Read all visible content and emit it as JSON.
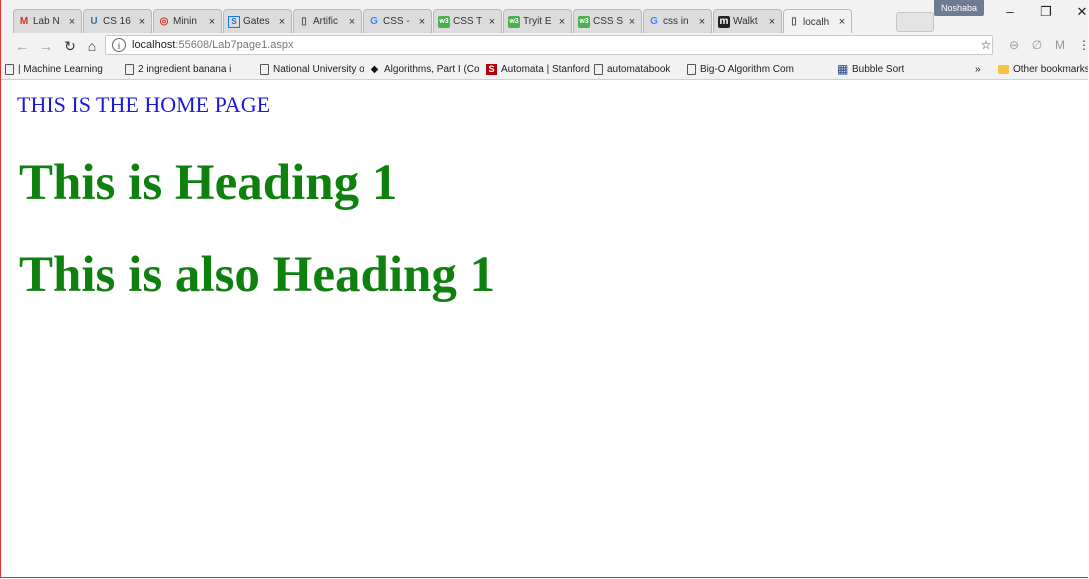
{
  "tabs": [
    {
      "label": "Lab N",
      "icon": "gmail-icon",
      "color": "#d93025"
    },
    {
      "label": "CS 16",
      "icon": "ucla-icon",
      "color": "#2774ae"
    },
    {
      "label": "Minin",
      "icon": "target-icon",
      "color": "#d93025"
    },
    {
      "label": "Gates",
      "icon": "s-icon",
      "color": "#1a73e8"
    },
    {
      "label": "Artific",
      "icon": "page-icon",
      "color": "#555555"
    },
    {
      "label": "CSS -",
      "icon": "google-icon",
      "color": "#4285f4"
    },
    {
      "label": "CSS T",
      "icon": "w3-icon",
      "color": "#4caf50"
    },
    {
      "label": "Tryit E",
      "icon": "w3-icon",
      "color": "#4caf50"
    },
    {
      "label": "CSS S",
      "icon": "w3-icon",
      "color": "#4caf50"
    },
    {
      "label": "css in",
      "icon": "google-icon",
      "color": "#4285f4"
    },
    {
      "label": "Walkt",
      "icon": "m-icon",
      "color": "#222222"
    },
    {
      "label": "localh",
      "icon": "page-icon",
      "color": "#555555"
    }
  ],
  "profile_name": "Noshaba",
  "window_controls": {
    "minimize": "–",
    "restore": "❐",
    "close": "✕"
  },
  "omnibox": {
    "host": "localhost",
    "path": ":55608/Lab7page1.aspx"
  },
  "bookmarks": [
    {
      "label": "| Machine Learning",
      "icon": "page-icon"
    },
    {
      "label": "2 ingredient banana i",
      "icon": "page-icon"
    },
    {
      "label": "National University of",
      "icon": "page-icon"
    },
    {
      "label": "Algorithms, Part I (Co",
      "icon": "diamond-icon"
    },
    {
      "label": "Automata | Stanford C",
      "icon": "s-icon"
    },
    {
      "label": "automatabook",
      "icon": "page-icon"
    },
    {
      "label": "Big-O Algorithm Com",
      "icon": "page-icon"
    },
    {
      "label": "Bubble Sort",
      "icon": "grid-icon"
    }
  ],
  "bookmarks_overflow": "»",
  "other_bookmarks": "Other bookmarks",
  "page": {
    "home_text": "THIS IS THE HOME PAGE",
    "heading1": "This is Heading 1",
    "heading2": "This is also Heading 1"
  },
  "colors": {
    "home_text": "#1a1adb",
    "heading": "#0d800d",
    "window_border": "#e0332f"
  }
}
